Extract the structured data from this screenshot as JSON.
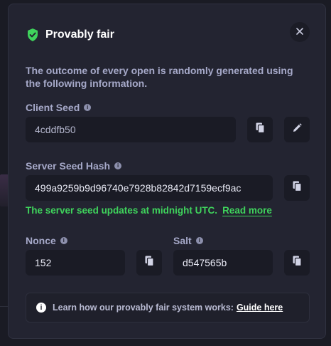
{
  "modal": {
    "title": "Provably fair",
    "description": "The outcome of every open is randomly generated using the following information."
  },
  "client_seed": {
    "label": "Client Seed",
    "value": "4cddfb50"
  },
  "server_seed_hash": {
    "label": "Server Seed Hash",
    "value": "499a9259b9d96740e7928b82842d7159ecf9ac"
  },
  "server_note": {
    "text": "The server seed updates at midnight UTC.",
    "link": "Read more"
  },
  "nonce": {
    "label": "Nonce",
    "value": "152"
  },
  "salt": {
    "label": "Salt",
    "value": "d547565b"
  },
  "guide": {
    "text": "Learn how our provably fair system works:",
    "link": "Guide here"
  },
  "icons": {
    "info_glyph": "i",
    "close": "close-icon",
    "copy": "copy-icon",
    "edit": "pencil-icon",
    "shield": "shield-check-icon"
  },
  "colors": {
    "accent_green": "#3fd35c",
    "modal_bg": "#232431",
    "field_bg": "#1a1b25",
    "label_text": "#a6a9c9"
  }
}
